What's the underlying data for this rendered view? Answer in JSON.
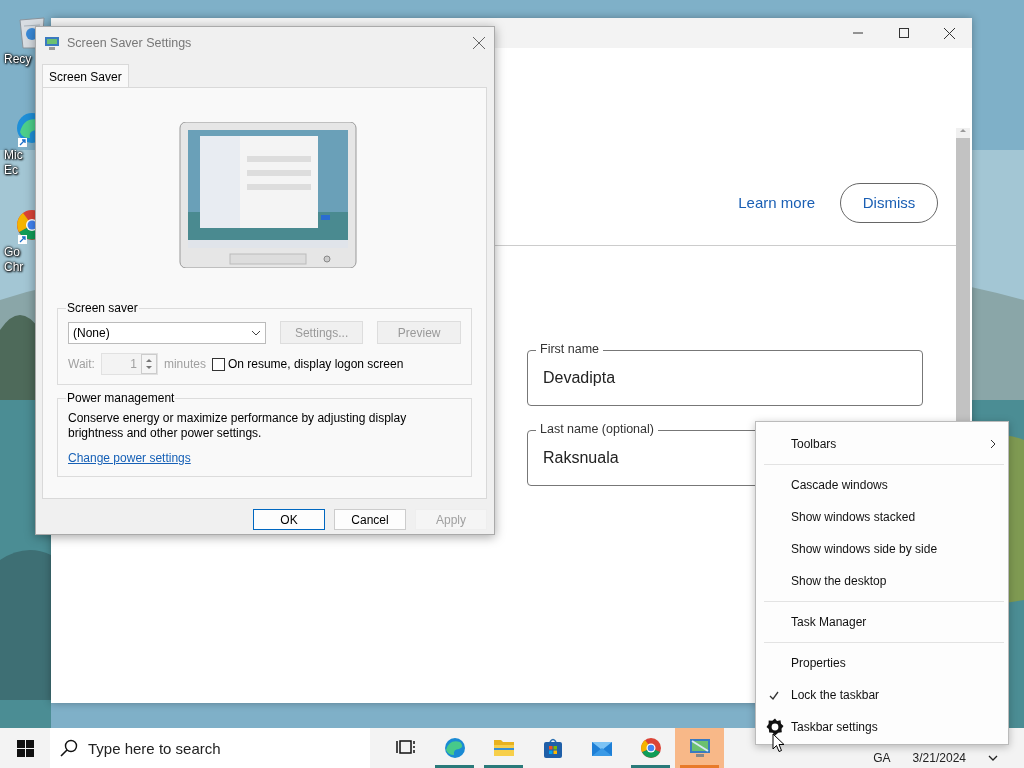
{
  "desktop": {
    "icons": [
      {
        "kind": "bin",
        "lines": [
          "Recy"
        ]
      },
      {
        "kind": "edge",
        "lines": [
          "Mic",
          "Ec"
        ]
      },
      {
        "kind": "chrome",
        "lines": [
          "Go",
          "Chr"
        ]
      }
    ]
  },
  "browser": {
    "banner": {
      "link": "Learn more",
      "button": "Dismiss"
    },
    "fields": [
      {
        "label": "First name",
        "value": "Devadipta"
      },
      {
        "label": "Last name (optional)",
        "value": "Raksnuala"
      }
    ]
  },
  "dialog": {
    "title": "Screen Saver Settings",
    "tabs": [
      {
        "label": "Screen Saver",
        "selected": true
      }
    ],
    "screen_saver": {
      "legend": "Screen saver",
      "select": "(None)",
      "buttons": [
        {
          "label": "Settings...",
          "disabled": true
        },
        {
          "label": "Preview",
          "disabled": true
        }
      ],
      "wait": {
        "label": "Wait:",
        "value": "1",
        "unit": "minutes",
        "disabled": true
      },
      "logon": {
        "label": "On resume, display logon screen",
        "checked": false
      }
    },
    "power": {
      "legend": "Power management",
      "text": "Conserve energy or maximize performance by adjusting display brightness and other power settings.",
      "link": "Change power settings"
    },
    "buttons": [
      {
        "label": "OK",
        "disabled": false,
        "default": true
      },
      {
        "label": "Cancel",
        "disabled": false,
        "default": false
      },
      {
        "label": "Apply",
        "disabled": true,
        "default": false
      }
    ]
  },
  "context_menu": {
    "items": [
      {
        "kind": "submenu",
        "label": "Toolbars"
      },
      {
        "kind": "separator"
      },
      {
        "kind": "command",
        "label": "Cascade windows"
      },
      {
        "kind": "command",
        "label": "Show windows stacked"
      },
      {
        "kind": "command",
        "label": "Show windows side by side"
      },
      {
        "kind": "command",
        "label": "Show the desktop"
      },
      {
        "kind": "separator"
      },
      {
        "kind": "command",
        "label": "Task Manager"
      },
      {
        "kind": "separator"
      },
      {
        "kind": "command",
        "label": "Properties"
      },
      {
        "kind": "check",
        "label": "Lock the taskbar",
        "checked": true
      },
      {
        "kind": "settings",
        "label": "Taskbar settings"
      }
    ]
  },
  "taskbar": {
    "search": {
      "placeholder": "Type here to search"
    },
    "apps": [
      {
        "kind": "taskview",
        "running": false,
        "selected": false
      },
      {
        "kind": "edge",
        "running": true,
        "selected": false
      },
      {
        "kind": "folder",
        "running": true,
        "selected": false
      },
      {
        "kind": "store",
        "running": false,
        "selected": false
      },
      {
        "kind": "mail",
        "running": false,
        "selected": false
      },
      {
        "kind": "chrome",
        "running": true,
        "selected": false
      },
      {
        "kind": "screensaver",
        "running": true,
        "selected": true
      }
    ],
    "tray": [
      "GA",
      "3/21/2024"
    ]
  }
}
